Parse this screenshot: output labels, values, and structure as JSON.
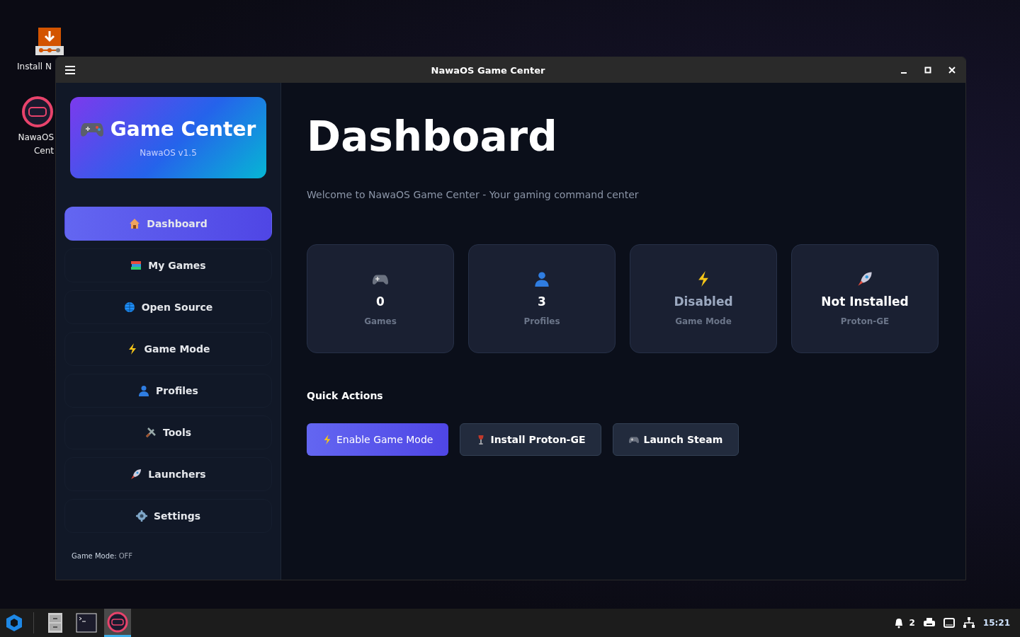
{
  "desktop_icons": [
    {
      "label": "Install N"
    },
    {
      "label": "NawaOS Cent"
    }
  ],
  "window": {
    "title": "NawaOS Game Center"
  },
  "sidebar": {
    "brand": {
      "title": "Game Center",
      "version": "NawaOS v1.5"
    },
    "items": [
      {
        "label": "Dashboard",
        "selected": true
      },
      {
        "label": "My Games",
        "selected": false
      },
      {
        "label": "Open Source",
        "selected": false
      },
      {
        "label": "Game Mode",
        "selected": false
      },
      {
        "label": "Profiles",
        "selected": false
      },
      {
        "label": "Tools",
        "selected": false
      },
      {
        "label": "Launchers",
        "selected": false
      },
      {
        "label": "Settings",
        "selected": false
      }
    ],
    "status": {
      "label": "Game Mode:",
      "value": "OFF"
    }
  },
  "main": {
    "heading": "Dashboard",
    "subtitle": "Welcome to NawaOS Game Center - Your gaming command center",
    "stats": [
      {
        "value": "0",
        "label": "Games",
        "dimmed": false
      },
      {
        "value": "3",
        "label": "Profiles",
        "dimmed": false
      },
      {
        "value": "Disabled",
        "label": "Game Mode",
        "dimmed": true
      },
      {
        "value": "Not Installed",
        "label": "Proton-GE",
        "dimmed": false
      }
    ],
    "quick_actions_title": "Quick Actions",
    "actions": [
      {
        "label": "Enable Game Mode",
        "kind": "primary"
      },
      {
        "label": "Install Proton-GE",
        "kind": "secondary"
      },
      {
        "label": "Launch Steam",
        "kind": "secondary"
      }
    ]
  },
  "taskbar": {
    "apps": [
      {
        "selected": false
      },
      {
        "selected": false
      },
      {
        "selected": true
      }
    ],
    "notifications": "2",
    "clock": "15:21"
  }
}
